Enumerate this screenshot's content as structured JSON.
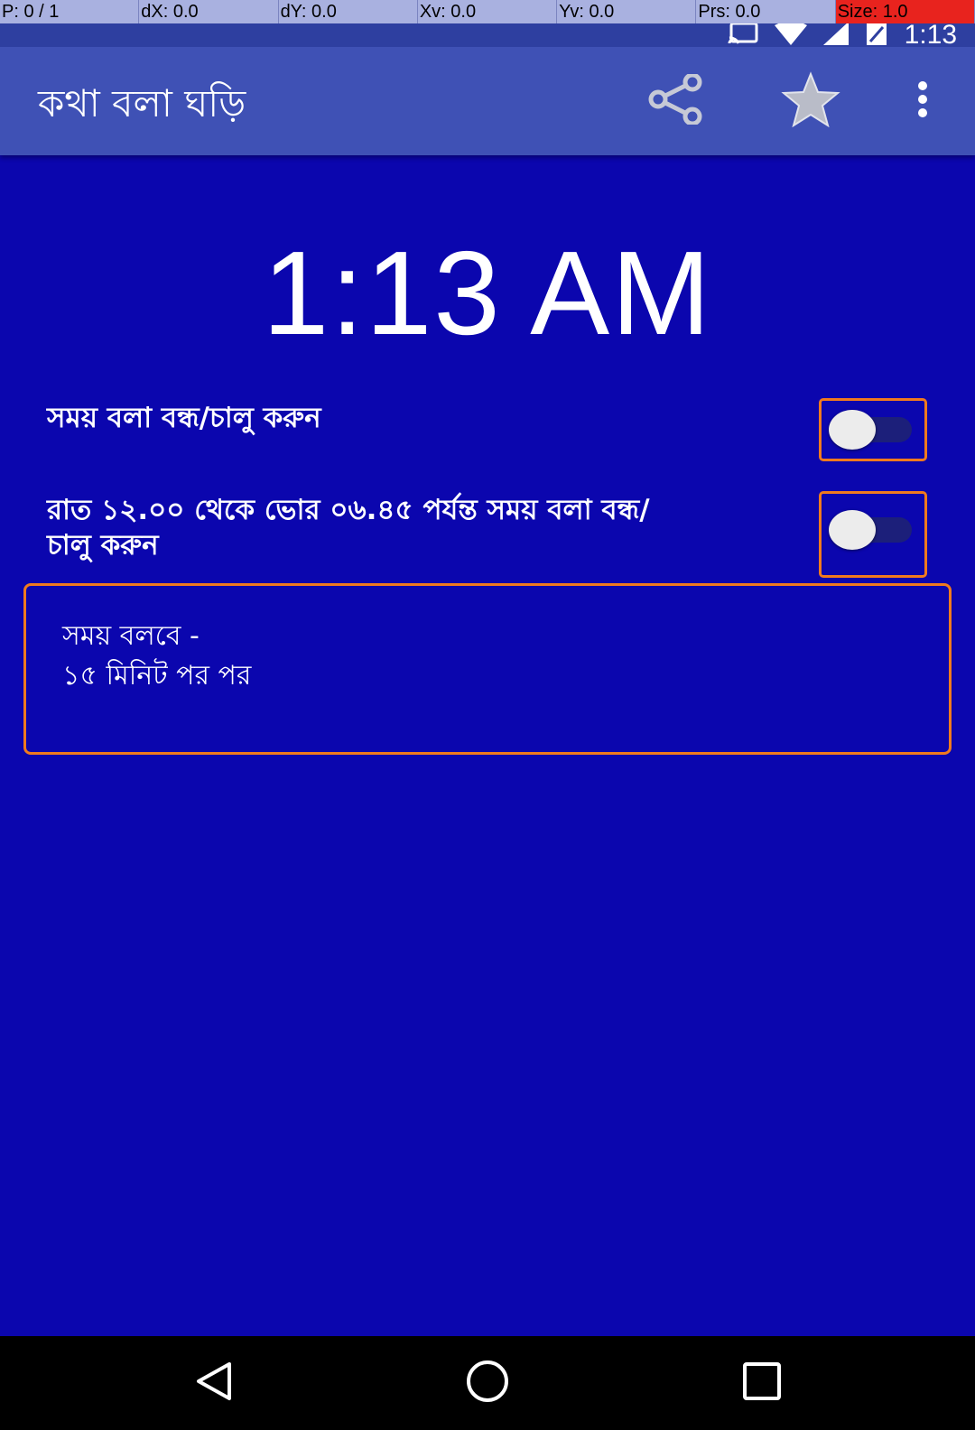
{
  "debug": {
    "cells": [
      "P: 0 / 1",
      "dX: 0.0",
      "dY: 0.0",
      "Xv: 0.0",
      "Yv: 0.0",
      "Prs: 0.0",
      "Size: 1.0"
    ]
  },
  "status_bar": {
    "time": "1:13",
    "icons": [
      "cast-icon",
      "wifi-icon",
      "signal-icon",
      "battery-icon"
    ]
  },
  "app_bar": {
    "title": "কথা বলা ঘড়ি",
    "actions": [
      "share-icon",
      "star-icon",
      "overflow-menu-icon"
    ]
  },
  "clock": {
    "time": "1:13 AM"
  },
  "settings": {
    "toggle_speech": {
      "label": "সময় বলা বন্ধ/চালু করুন",
      "checked": false
    },
    "toggle_night": {
      "label_line1": "রাত ১২.০০ থেকে ভোর ০৬.৪৫ পর্যন্ত সময় বলা বন্ধ/",
      "label_line2": "চালু করুন",
      "checked": false
    }
  },
  "interval": {
    "heading": "সময় বলবে -",
    "value": "১৫ মিনিট পর পর"
  },
  "colors": {
    "background": "#0b06ae",
    "app_bar": "#3f51b5",
    "accent_outline": "#f07a1e"
  },
  "nav_bar": {
    "buttons": [
      "back-icon",
      "home-icon",
      "recents-icon"
    ]
  }
}
